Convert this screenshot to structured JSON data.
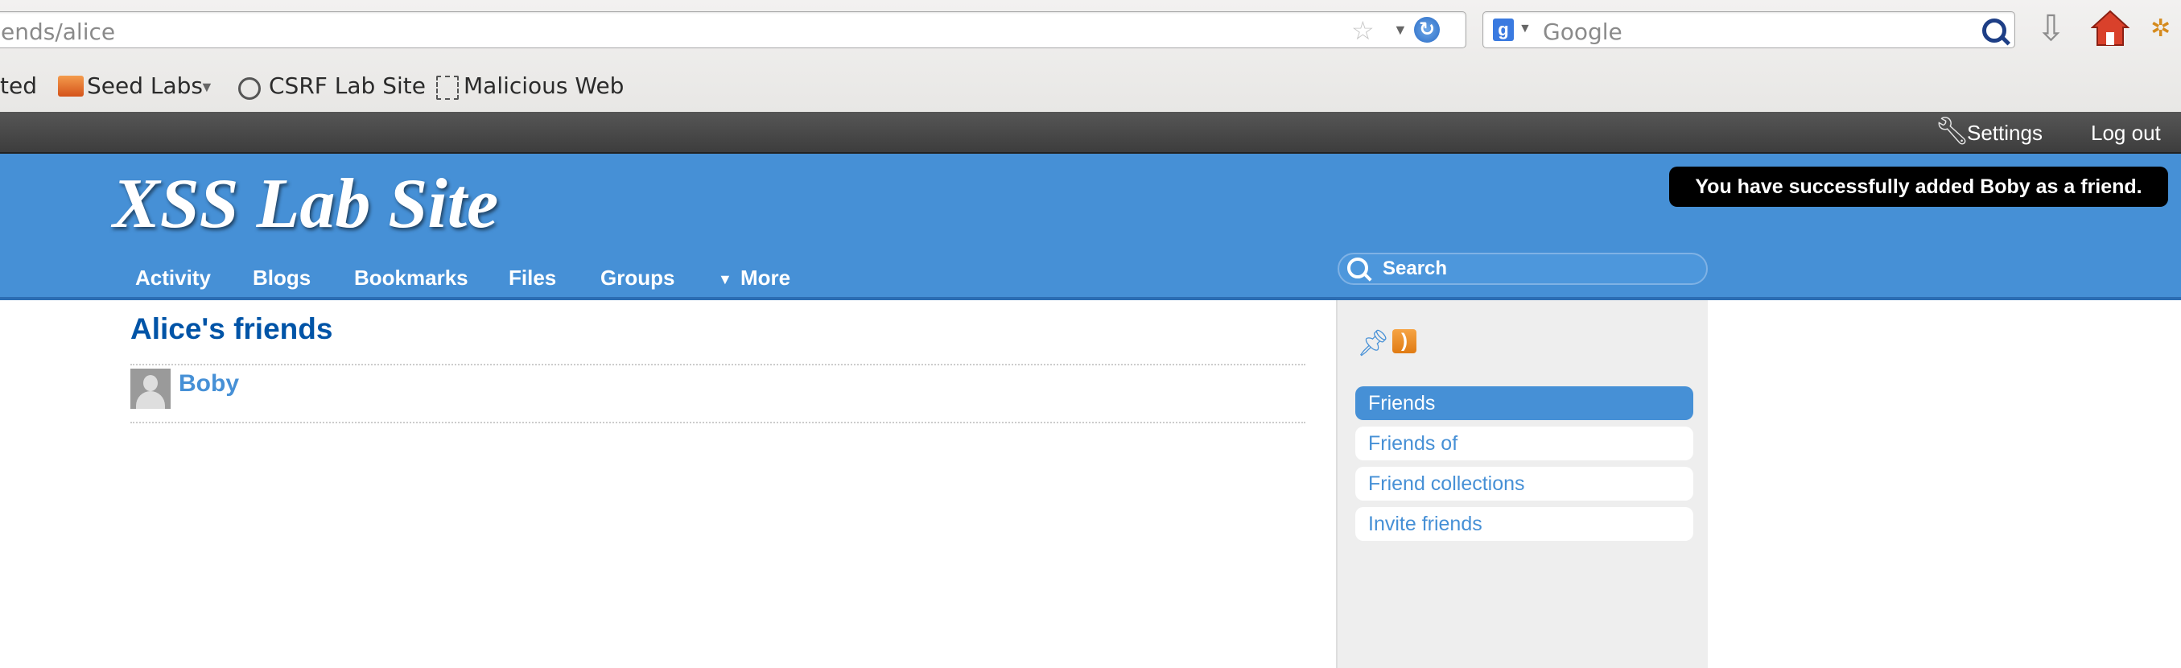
{
  "browser": {
    "url": "ends/alice",
    "search_placeholder": "Google",
    "bookmarks": {
      "partial_item": "ted",
      "seed_labs": "Seed Labs",
      "csrf_lab_site": "CSRF Lab Site",
      "malicious_web": "Malicious Web"
    },
    "icons": [
      "star-icon",
      "reload-icon",
      "google-icon",
      "magnifier-icon",
      "download-icon",
      "home-icon",
      "addon-icon"
    ]
  },
  "topbar": {
    "settings": "Settings",
    "logout": "Log out"
  },
  "header": {
    "site_title": "XSS Lab Site",
    "nav": [
      "Activity",
      "Blogs",
      "Bookmarks",
      "Files",
      "Groups",
      "More"
    ],
    "search_placeholder": "Search",
    "system_message": "You have successfully added Boby as a friend."
  },
  "main": {
    "title": "Alice's friends",
    "friends": [
      {
        "name": "Boby"
      }
    ]
  },
  "sidebar": {
    "items": [
      {
        "label": "Friends",
        "active": true
      },
      {
        "label": "Friends of",
        "active": false
      },
      {
        "label": "Friend collections",
        "active": false
      },
      {
        "label": "Invite friends",
        "active": false
      }
    ]
  },
  "colors": {
    "brand_blue": "#4690d6",
    "title_blue": "#0054a7",
    "topbar_dark": "#474747",
    "message_bg": "#000000"
  }
}
